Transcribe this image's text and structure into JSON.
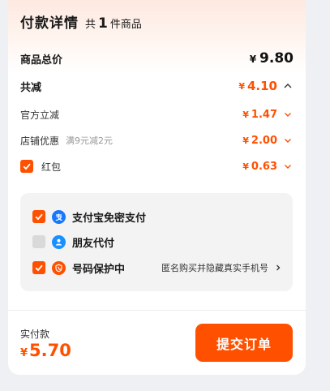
{
  "header": {
    "title": "付款详情",
    "count_prefix": "共",
    "count": "1",
    "count_suffix": "件商品"
  },
  "summary": {
    "goods_total_label": "商品总价",
    "goods_total_currency": "¥",
    "goods_total_value": "9.80",
    "discount_label": "共减",
    "discount_currency": "¥",
    "discount_value": "4.10"
  },
  "discounts": [
    {
      "label": "官方立减",
      "sub": "",
      "currency": "¥",
      "value": "1.47"
    },
    {
      "label": "店铺优惠",
      "sub": "满9元减2元",
      "currency": "¥",
      "value": "2.00"
    },
    {
      "label": "红包",
      "sub": "",
      "currency": "¥",
      "value": "0.63",
      "checked": true
    }
  ],
  "payment_options": [
    {
      "label": "支付宝免密支付",
      "checked": true,
      "icon": "alipay-icon",
      "color": "#1677ff"
    },
    {
      "label": "朋友代付",
      "checked": false,
      "icon": "friend-pay-icon",
      "color": "#1890ff"
    },
    {
      "label": "号码保护中",
      "checked": true,
      "icon": "phone-protect-icon",
      "color": "#ff5000",
      "hint": "匿名购买并隐藏真实手机号"
    }
  ],
  "footer": {
    "total_label": "实付款",
    "total_currency": "¥",
    "total_value": "5.70",
    "submit_label": "提交订单"
  },
  "colors": {
    "accent": "#ff5000",
    "box_bg": "#f3f3f4",
    "page_bg": "#eef0f4"
  }
}
